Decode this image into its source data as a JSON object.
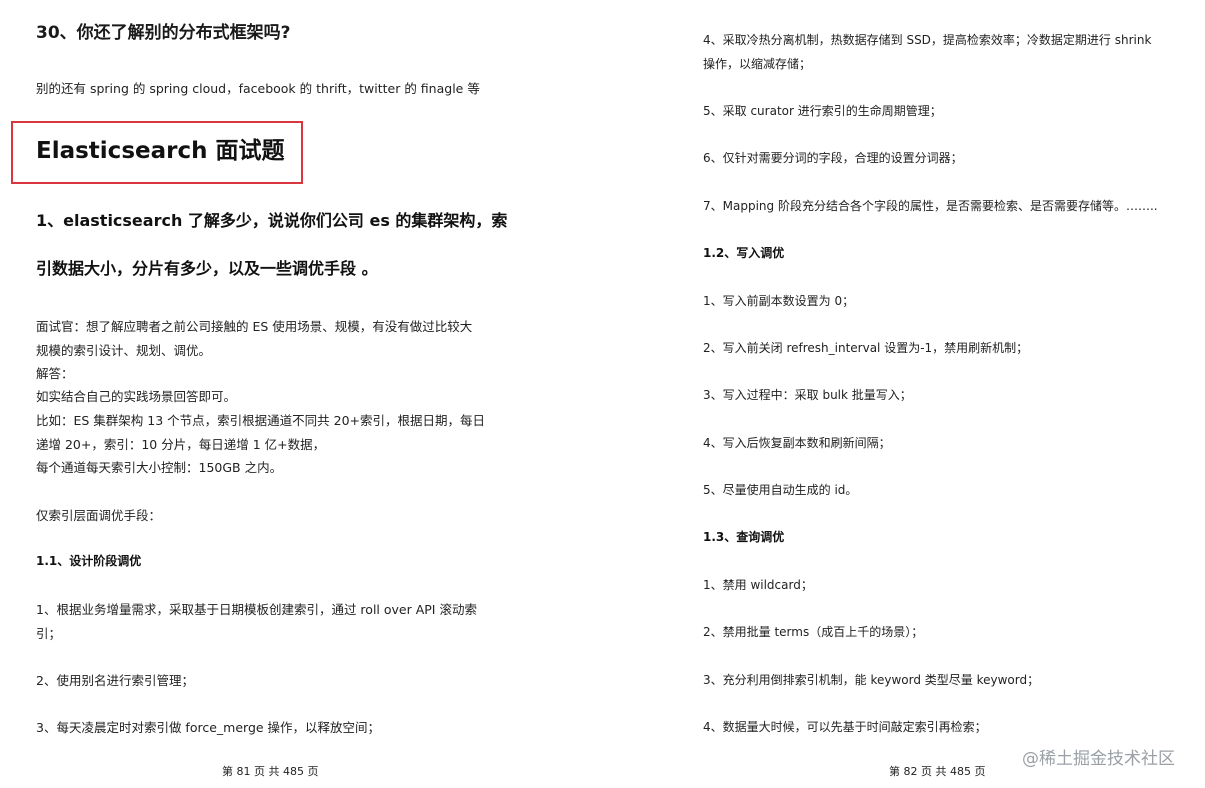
{
  "left_page": {
    "q30_title": "30、你还了解别的分布式框架吗?",
    "q30_answer": "别的还有 spring 的 spring cloud，facebook 的 thrift，twitter 的 finagle 等",
    "section_title": "Elasticsearch  面试题",
    "q1_title_line1": "1、elasticsearch 了解多少，说说你们公司 es 的集群架构，索",
    "q1_title_line2": "引数据大小，分片有多少，以及一些调优手段 。",
    "interviewer_line1": "面试官：想了解应聘者之前公司接触的 ES 使用场景、规模，有没有做过比较大",
    "interviewer_line2": "规模的索引设计、规划、调优。",
    "answer_label": "解答：",
    "answer_text": "如实结合自己的实践场景回答即可。",
    "example_line1": "比如：ES 集群架构 13 个节点，索引根据通道不同共 20+索引，根据日期，每日",
    "example_line2": "递增 20+，索引：10 分片，每日递增 1 亿+数据，",
    "example_line3": "每个通道每天索引大小控制：150GB 之内。",
    "tuning_intro": "仅索引层面调优手段：",
    "sub_1_1": "1.1、设计阶段调优",
    "item1_line1": "1、根据业务增量需求，采取基于日期模板创建索引，通过 roll over API 滚动索",
    "item1_line2": "引；",
    "item2": "2、使用别名进行索引管理；",
    "item3": "3、每天凌晨定时对索引做 force_merge 操作，以释放空间；",
    "footer": "第 81 页 共 485 页"
  },
  "right_page": {
    "item4_line1": "4、采取冷热分离机制，热数据存储到 SSD，提高检索效率；冷数据定期进行 shrink",
    "item4_line2": "操作，以缩减存储；",
    "item5": "5、采取 curator 进行索引的生命周期管理；",
    "item6": "6、仅针对需要分词的字段，合理的设置分词器；",
    "item7": "7、Mapping 阶段充分结合各个字段的属性，是否需要检索、是否需要存储等。……..",
    "sub_1_2": "1.2、写入调优",
    "w1": "1、写入前副本数设置为 0；",
    "w2": "2、写入前关闭 refresh_interval 设置为-1，禁用刷新机制；",
    "w3": "3、写入过程中：采取 bulk 批量写入；",
    "w4": "4、写入后恢复副本数和刷新间隔；",
    "w5": "5、尽量使用自动生成的 id。",
    "sub_1_3": "1.3、查询调优",
    "q1": "1、禁用 wildcard；",
    "q2": "2、禁用批量 terms（成百上千的场景）；",
    "q3": "3、充分利用倒排索引机制，能 keyword 类型尽量 keyword；",
    "q4": "4、数据量大时候，可以先基于时间敲定索引再检索；",
    "footer": "第 82 页 共 485 页"
  },
  "watermark": "@稀土掘金技术社区",
  "colors": {
    "highlight_box": "#d9363e",
    "watermark": "#9aa0a6"
  }
}
